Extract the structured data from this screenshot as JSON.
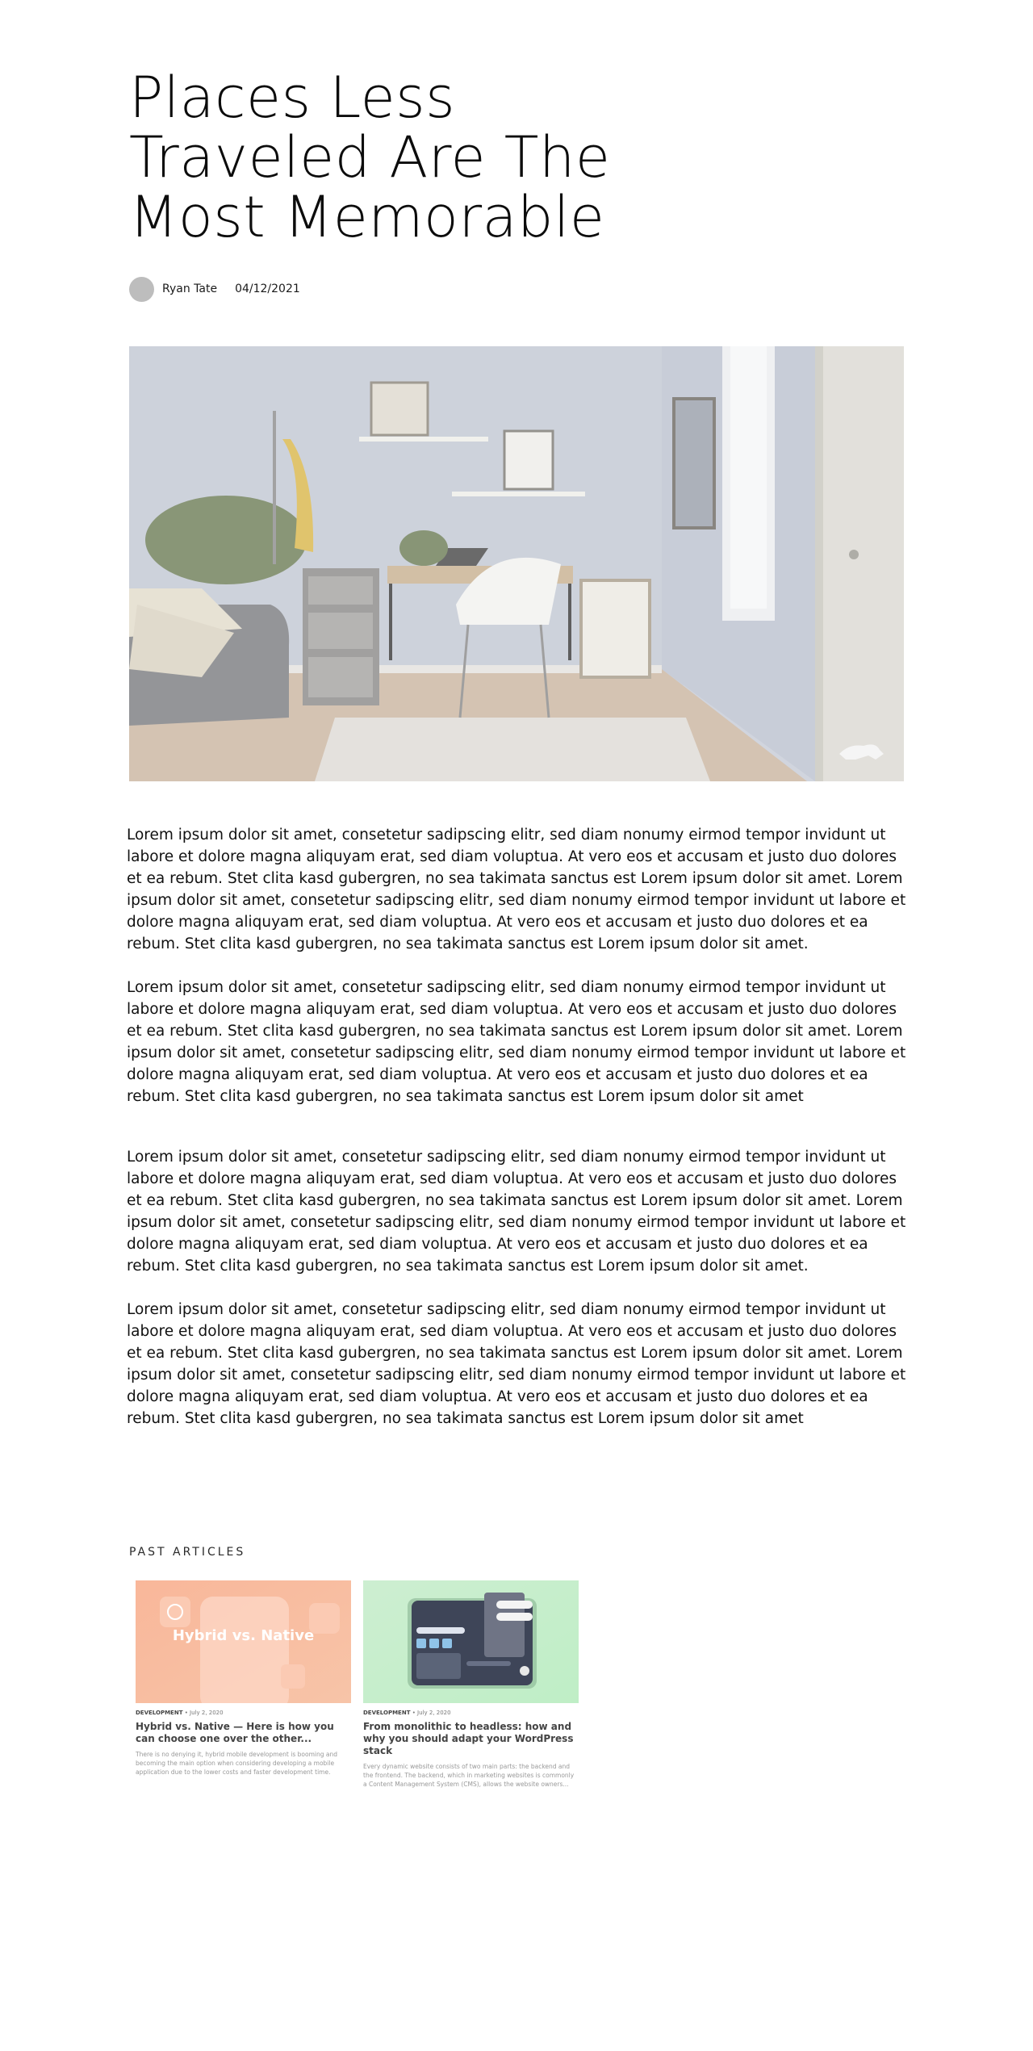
{
  "article": {
    "title": "Places Less Traveled Are The Most Memorable",
    "author": "Ryan Tate",
    "date": "04/12/2021"
  },
  "body": {
    "paragraphs": [
      "Lorem ipsum dolor sit amet, consetetur sadipscing elitr, sed diam nonumy eirmod tempor invidunt ut labore et dolore magna aliquyam erat, sed diam voluptua. At vero eos et accusam et justo duo dolores et ea rebum. Stet clita kasd gubergren, no sea takimata sanctus est Lorem ipsum dolor sit amet. Lorem ipsum dolor sit amet, consetetur sadipscing elitr, sed diam nonumy eirmod tempor invidunt ut labore et dolore magna aliquyam erat, sed diam voluptua. At vero eos et accusam et justo duo dolores et ea rebum. Stet clita kasd gubergren, no sea takimata sanctus est Lorem ipsum dolor sit amet.",
      "Lorem ipsum dolor sit amet, consetetur sadipscing elitr, sed diam nonumy eirmod tempor invidunt ut labore et dolore magna aliquyam erat, sed diam voluptua. At vero eos et accusam et justo duo dolores et ea rebum. Stet clita kasd gubergren, no sea takimata sanctus est Lorem ipsum dolor sit amet. Lorem ipsum dolor sit amet, consetetur sadipscing elitr, sed diam nonumy eirmod tempor invidunt ut labore et dolore magna aliquyam erat, sed diam voluptua. At vero eos et accusam et justo duo dolores et ea rebum. Stet clita kasd gubergren, no sea takimata sanctus est Lorem ipsum dolor sit amet",
      "Lorem ipsum dolor sit amet, consetetur sadipscing elitr, sed diam nonumy eirmod tempor invidunt ut labore et dolore magna aliquyam erat, sed diam voluptua. At vero eos et accusam et justo duo dolores et ea rebum. Stet clita kasd gubergren, no sea takimata sanctus est Lorem ipsum dolor sit amet. Lorem ipsum dolor sit amet, consetetur sadipscing elitr, sed diam nonumy eirmod tempor invidunt ut labore et dolore magna aliquyam erat, sed diam voluptua. At vero eos et accusam et justo duo dolores et ea rebum. Stet clita kasd gubergren, no sea takimata sanctus est Lorem ipsum dolor sit amet.",
      "Lorem ipsum dolor sit amet, consetetur sadipscing elitr, sed diam nonumy eirmod tempor invidunt ut labore et dolore magna aliquyam erat, sed diam voluptua. At vero eos et accusam et justo duo dolores et ea rebum. Stet clita kasd gubergren, no sea takimata sanctus est Lorem ipsum dolor sit amet. Lorem ipsum dolor sit amet, consetetur sadipscing elitr, sed diam nonumy eirmod tempor invidunt ut labore et dolore magna aliquyam erat, sed diam voluptua. At vero eos et accusam et justo duo dolores et ea rebum. Stet clita kasd gubergren, no sea takimata sanctus est Lorem ipsum dolor sit amet"
    ]
  },
  "past_articles": {
    "heading": "PAST ARTICLES",
    "cards": [
      {
        "thumb_text": "Hybrid vs. Native",
        "category": "DEVELOPMENT",
        "date": "• July 2, 2020",
        "title": "Hybrid vs. Native — Here is how you can choose one over the other...",
        "excerpt": "There is no denying it, hybrid mobile development is booming and becoming the main option when considering developing a mobile application due to the lower costs and faster development time."
      },
      {
        "thumb_text": "",
        "category": "DEVELOPMENT",
        "date": "• July 2, 2020",
        "title": "From monolithic to headless: how and why you should adapt your WordPress stack",
        "excerpt": "Every dynamic website consists of two main parts: the backend and the frontend. The backend, which in marketing websites is commonly a Content Management System (CMS), allows the website owners..."
      }
    ]
  }
}
